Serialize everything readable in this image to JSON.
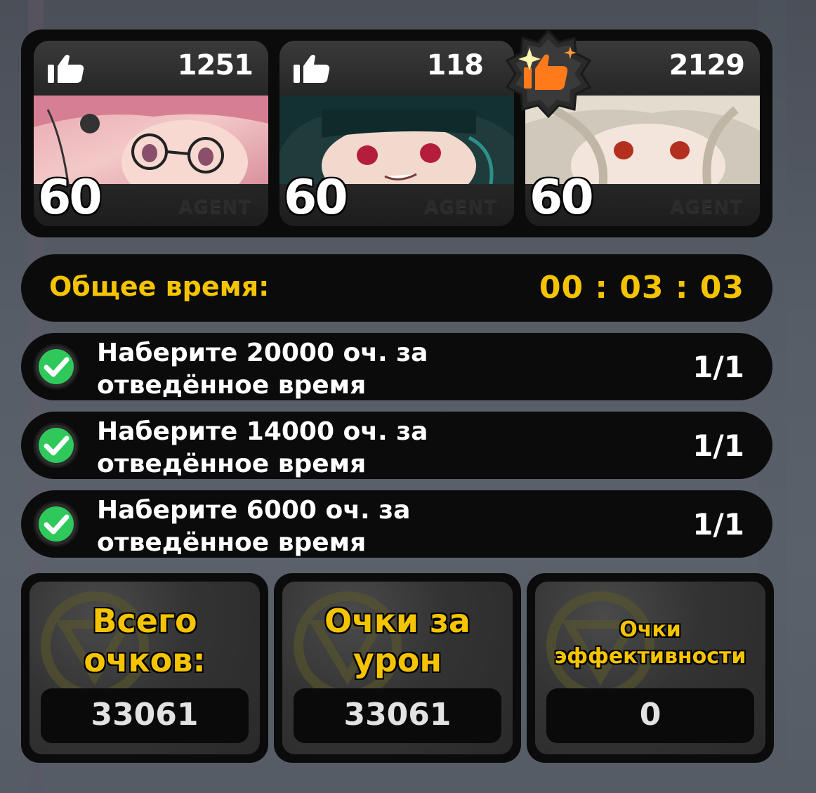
{
  "agents": [
    {
      "likes": "1251",
      "level": "60",
      "label": "AGENT"
    },
    {
      "likes": "118",
      "level": "60",
      "label": "AGENT"
    },
    {
      "likes": "2129",
      "level": "60",
      "label": "AGENT"
    }
  ],
  "icons": {
    "likes": "thumbs-up-icon",
    "boost": "thumbs-up-sparkle-icon",
    "check": "check-circle-icon"
  },
  "colors": {
    "accent": "#f5c400",
    "check_green": "#2ec95a",
    "panel": "#0b0b0b"
  },
  "time": {
    "label": "Общее время:",
    "value": "00 : 03 : 03"
  },
  "objectives": [
    {
      "line1": "Наберите 20000 оч. за",
      "line2": "отведённое время",
      "progress": "1/1"
    },
    {
      "line1": "Наберите 14000 оч. за",
      "line2": "отведённое время",
      "progress": "1/1"
    },
    {
      "line1": "Наберите 6000 оч. за",
      "line2": "отведённое время",
      "progress": "1/1"
    }
  ],
  "scores": [
    {
      "title_line1": "Всего",
      "title_line2": "очков:",
      "value": "33061"
    },
    {
      "title_line1": "Очки за",
      "title_line2": "урон",
      "value": "33061"
    },
    {
      "title_line1": "Очки",
      "title_line2": "эффективности",
      "value": "0"
    }
  ]
}
